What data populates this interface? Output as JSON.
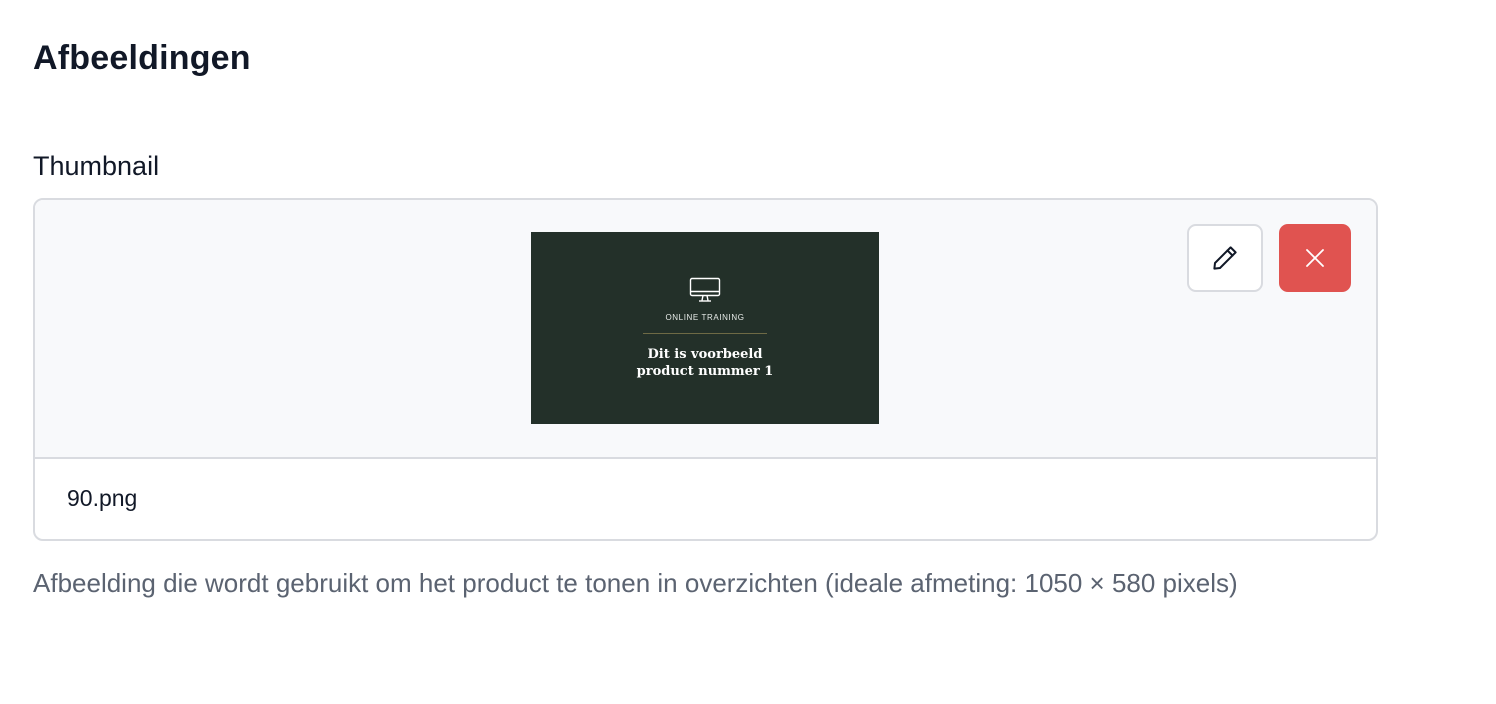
{
  "section": {
    "title": "Afbeeldingen"
  },
  "thumbnail_field": {
    "label": "Thumbnail",
    "preview": {
      "eyebrow": "ONLINE TRAINING",
      "title_line1": "Dit is voorbeeld",
      "title_line2": "product nummer 1",
      "icon": "monitor-icon",
      "background_color": "#233029"
    },
    "edit_button": {
      "icon": "pencil-icon"
    },
    "remove_button": {
      "icon": "close-icon",
      "color": "#e05350"
    },
    "filename": "90.png",
    "help_text": "Afbeelding die wordt gebruikt om het product te tonen in overzichten (ideale afmeting: 1050 × 580 pixels)"
  }
}
